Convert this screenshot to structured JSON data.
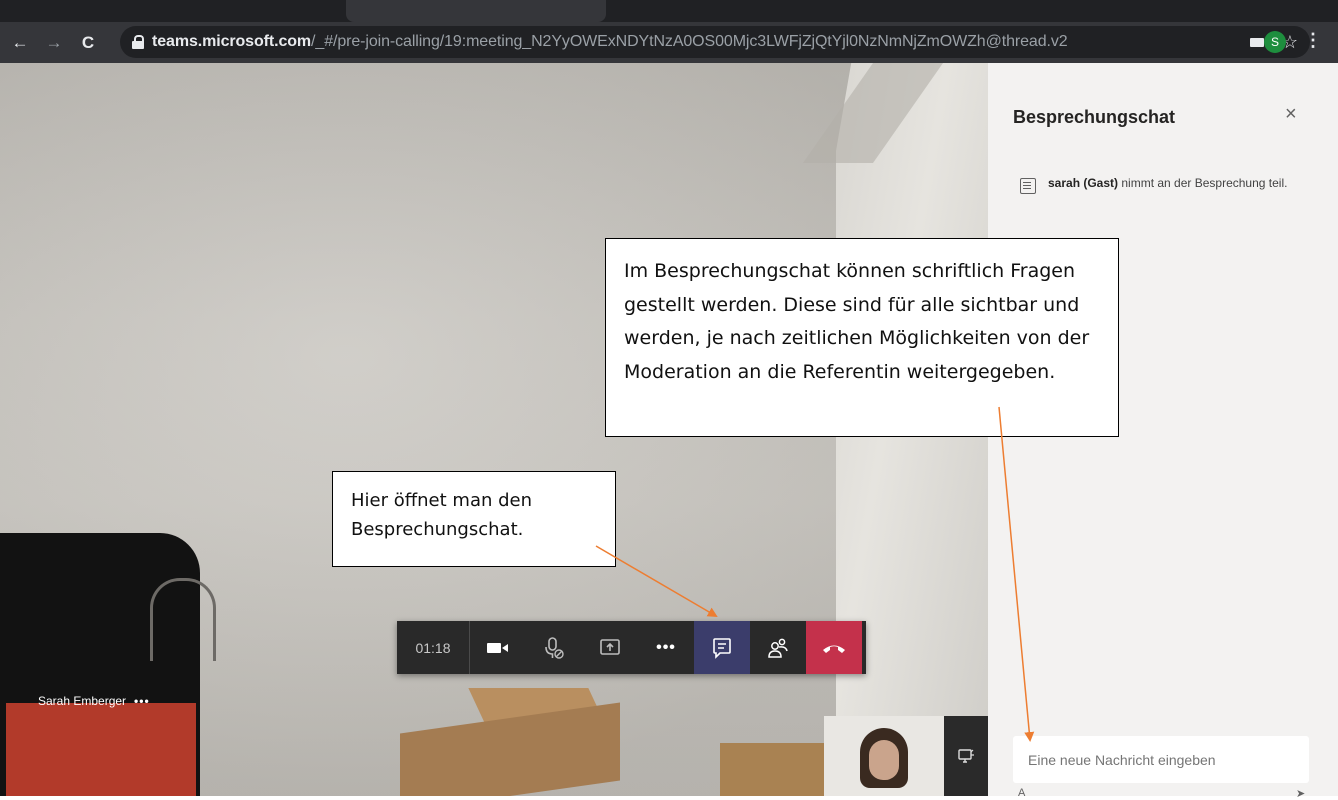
{
  "browser": {
    "url_host": "teams.microsoft.com",
    "url_path": "/_#/pre-join-calling/19:meeting_N2YyOWExNDYtNzA0OS00Mjc3LWFjZjQtYjl0NzNmNjZmOWZh@thread.v2",
    "profile_initial": "S",
    "nav_icons": [
      "back-icon",
      "forward-icon",
      "reload-icon"
    ]
  },
  "video": {
    "participant_name": "Sarah Emberger",
    "participant_more": "•••"
  },
  "callbar": {
    "timer": "01:18",
    "buttons": [
      "camera-icon",
      "microphone-muted-icon",
      "share-screen-icon",
      "more-options-icon",
      "chat-icon",
      "participants-icon",
      "hangup-icon"
    ],
    "more_label": "•••"
  },
  "chat": {
    "title": "Besprechungschat",
    "close_label": "×",
    "message_bold": "sarah (Gast)",
    "message_rest": " nimmt an der Besprechung teil.",
    "input_placeholder": "Eine neue Nachricht eingeben"
  },
  "annotations": {
    "chat_button_note": "Hier öffnet man den Besprechungschat.",
    "chat_panel_note": "Im Besprechungschat können schriftlich Fragen gestellt werden. Diese sind für alle sichtbar und werden, je nach zeitlichen Möglichkeiten von der Moderation an die Referentin weitergegeben."
  },
  "colors": {
    "annotation_arrow": "#ed7d31",
    "hangup": "#c4314b",
    "active_button": "#3b3d6b",
    "profile_badge": "#1e8e3e"
  }
}
